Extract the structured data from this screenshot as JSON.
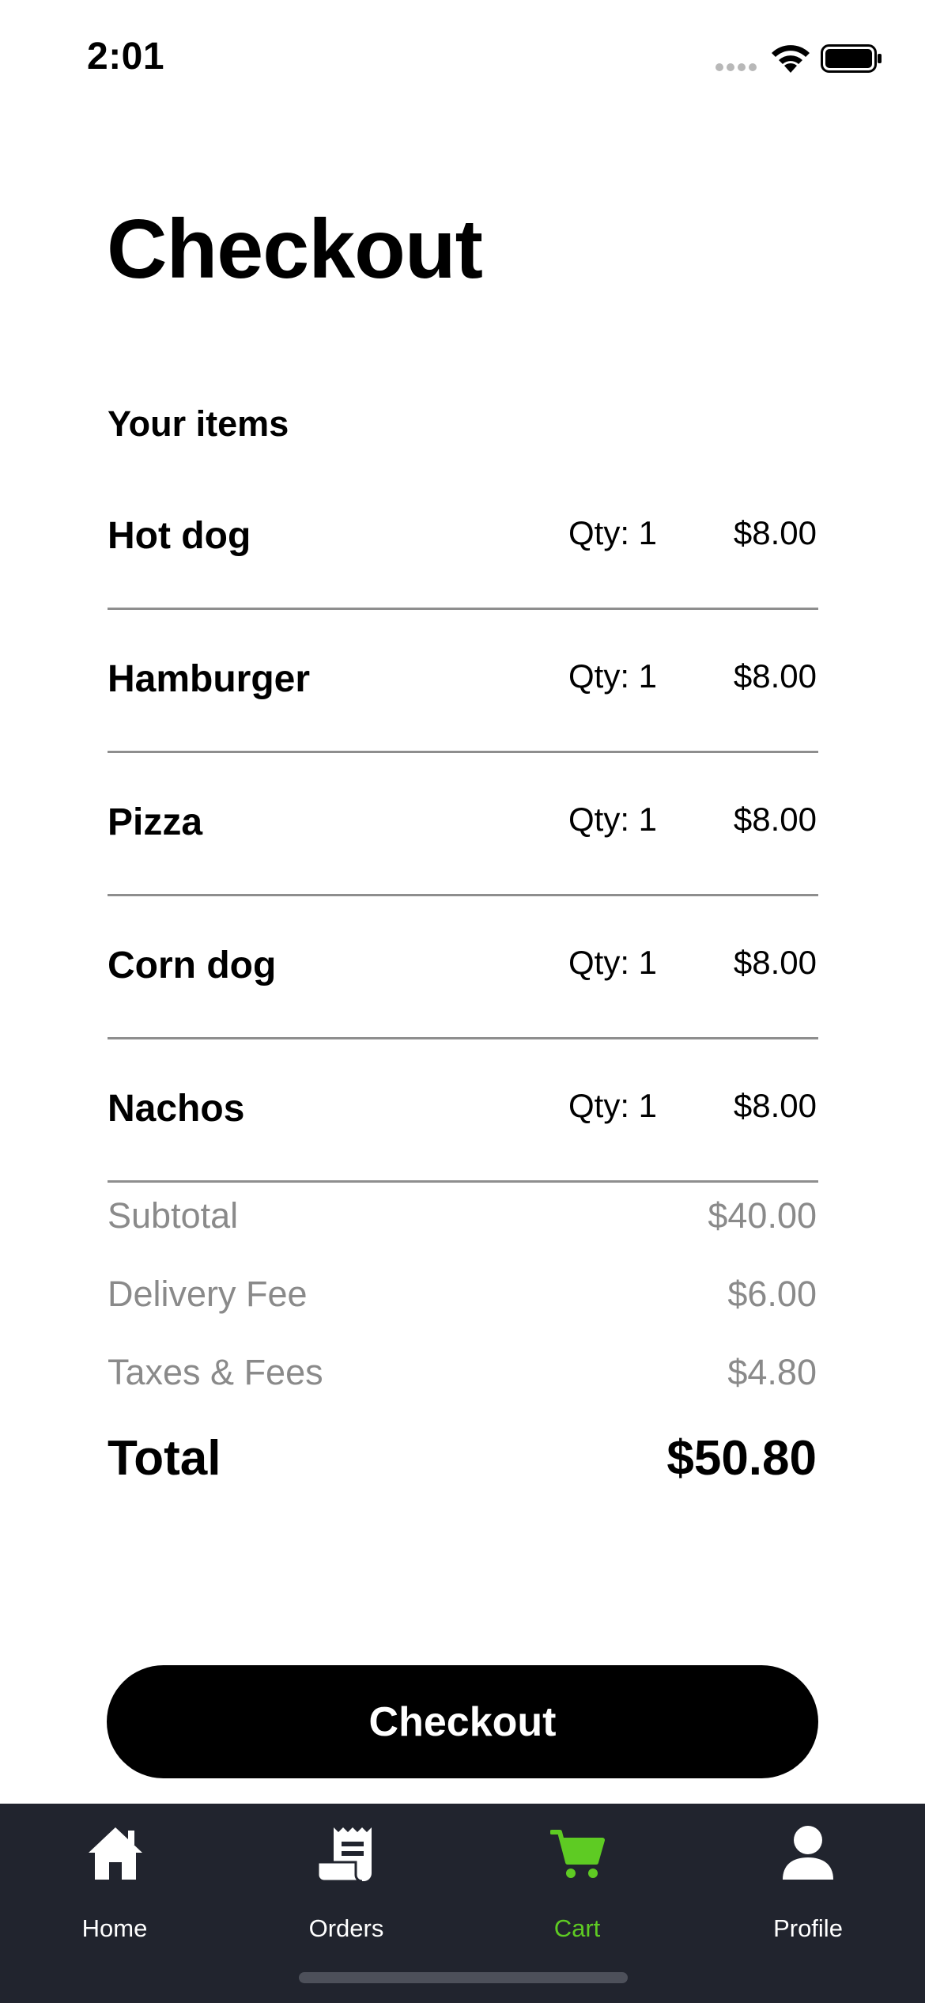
{
  "status_bar": {
    "time": "2:01"
  },
  "title": "Checkout",
  "section_label": "Your items",
  "items": [
    {
      "name": "Hot dog",
      "qty": "Qty: 1",
      "price": "$8.00"
    },
    {
      "name": "Hamburger",
      "qty": "Qty: 1",
      "price": "$8.00"
    },
    {
      "name": "Pizza",
      "qty": "Qty: 1",
      "price": "$8.00"
    },
    {
      "name": "Corn dog",
      "qty": "Qty: 1",
      "price": "$8.00"
    },
    {
      "name": "Nachos",
      "qty": "Qty: 1",
      "price": "$8.00"
    }
  ],
  "summary": {
    "subtotal_label": "Subtotal",
    "subtotal": "$40.00",
    "delivery_label": "Delivery Fee",
    "delivery": "$6.00",
    "taxes_label": "Taxes & Fees",
    "taxes": "$4.80",
    "total_label": "Total",
    "total": "$50.80"
  },
  "checkout_button": "Checkout",
  "tab_bar": {
    "active": "Cart",
    "active_color": "#5ecb23",
    "background": "#21242e",
    "tabs": [
      {
        "label": "Home",
        "icon": "house-icon"
      },
      {
        "label": "Orders",
        "icon": "receipt-icon"
      },
      {
        "label": "Cart",
        "icon": "cart-icon"
      },
      {
        "label": "Profile",
        "icon": "person-icon"
      }
    ]
  }
}
